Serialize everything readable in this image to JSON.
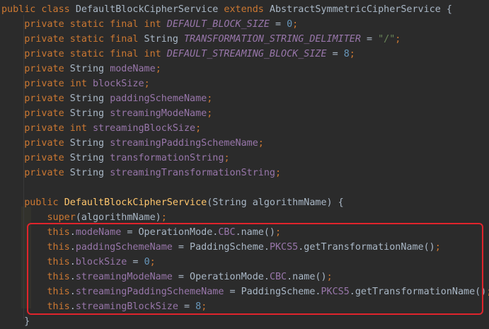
{
  "code": {
    "lines": [
      [
        {
          "t": "public class ",
          "c": "k"
        },
        {
          "t": "DefaultBlockCipherService ",
          "c": "p"
        },
        {
          "t": "extends ",
          "c": "k"
        },
        {
          "t": "AbstractSymmetricCipherService {",
          "c": "p"
        }
      ],
      [
        {
          "t": "    private static final int ",
          "c": "k"
        },
        {
          "t": "DEFAULT_BLOCK_SIZE",
          "c": "c"
        },
        {
          "t": " = ",
          "c": "p"
        },
        {
          "t": "0",
          "c": "n"
        },
        {
          "t": ";",
          "c": "k"
        }
      ],
      [
        {
          "t": "    private static final ",
          "c": "k"
        },
        {
          "t": "String ",
          "c": "p"
        },
        {
          "t": "TRANSFORMATION_STRING_DELIMITER",
          "c": "c"
        },
        {
          "t": " = ",
          "c": "p"
        },
        {
          "t": "\"/\"",
          "c": "s"
        },
        {
          "t": ";",
          "c": "k"
        }
      ],
      [
        {
          "t": "    private static final int ",
          "c": "k"
        },
        {
          "t": "DEFAULT_STREAMING_BLOCK_SIZE",
          "c": "c"
        },
        {
          "t": " = ",
          "c": "p"
        },
        {
          "t": "8",
          "c": "n"
        },
        {
          "t": ";",
          "c": "k"
        }
      ],
      [
        {
          "t": "    private ",
          "c": "k"
        },
        {
          "t": "String ",
          "c": "p"
        },
        {
          "t": "modeName",
          "c": "fi"
        },
        {
          "t": ";",
          "c": "k"
        }
      ],
      [
        {
          "t": "    private int ",
          "c": "k"
        },
        {
          "t": "blockSize",
          "c": "fi"
        },
        {
          "t": ";",
          "c": "k"
        }
      ],
      [
        {
          "t": "    private ",
          "c": "k"
        },
        {
          "t": "String ",
          "c": "p"
        },
        {
          "t": "paddingSchemeName",
          "c": "fi"
        },
        {
          "t": ";",
          "c": "k"
        }
      ],
      [
        {
          "t": "    private ",
          "c": "k"
        },
        {
          "t": "String ",
          "c": "p"
        },
        {
          "t": "streamingModeName",
          "c": "fi"
        },
        {
          "t": ";",
          "c": "k"
        }
      ],
      [
        {
          "t": "    private int ",
          "c": "k"
        },
        {
          "t": "streamingBlockSize",
          "c": "fi"
        },
        {
          "t": ";",
          "c": "k"
        }
      ],
      [
        {
          "t": "    private ",
          "c": "k"
        },
        {
          "t": "String ",
          "c": "p"
        },
        {
          "t": "streamingPaddingSchemeName",
          "c": "fi"
        },
        {
          "t": ";",
          "c": "k"
        }
      ],
      [
        {
          "t": "    private ",
          "c": "k"
        },
        {
          "t": "String ",
          "c": "p"
        },
        {
          "t": "transformationString",
          "c": "fi"
        },
        {
          "t": ";",
          "c": "k"
        }
      ],
      [
        {
          "t": "    private ",
          "c": "k"
        },
        {
          "t": "String ",
          "c": "p"
        },
        {
          "t": "streamingTransformationString",
          "c": "fi"
        },
        {
          "t": ";",
          "c": "k"
        }
      ],
      [],
      [
        {
          "t": "    public ",
          "c": "k"
        },
        {
          "t": "DefaultBlockCipherService",
          "c": "m"
        },
        {
          "t": "(String algorithmName) {",
          "c": "p"
        }
      ],
      [
        {
          "t": "        super",
          "c": "k"
        },
        {
          "t": "(algorithmName)",
          "c": "p"
        },
        {
          "t": ";",
          "c": "k"
        }
      ],
      [
        {
          "t": "        this",
          "c": "k"
        },
        {
          "t": ".",
          "c": "p"
        },
        {
          "t": "modeName",
          "c": "fi"
        },
        {
          "t": " = OperationMode.",
          "c": "p"
        },
        {
          "t": "CBC",
          "c": "fi"
        },
        {
          "t": ".name()",
          "c": "p"
        },
        {
          "t": ";",
          "c": "k"
        }
      ],
      [
        {
          "t": "        this",
          "c": "k"
        },
        {
          "t": ".",
          "c": "p"
        },
        {
          "t": "paddingSchemeName",
          "c": "fi"
        },
        {
          "t": " = PaddingScheme.",
          "c": "p"
        },
        {
          "t": "PKCS5",
          "c": "fi"
        },
        {
          "t": ".getTransformationName()",
          "c": "p"
        },
        {
          "t": ";",
          "c": "k"
        }
      ],
      [
        {
          "t": "        this",
          "c": "k"
        },
        {
          "t": ".",
          "c": "p"
        },
        {
          "t": "blockSize",
          "c": "fi"
        },
        {
          "t": " = ",
          "c": "p"
        },
        {
          "t": "0",
          "c": "n"
        },
        {
          "t": ";",
          "c": "k"
        }
      ],
      [
        {
          "t": "        this",
          "c": "k"
        },
        {
          "t": ".",
          "c": "p"
        },
        {
          "t": "streamingModeName",
          "c": "fi"
        },
        {
          "t": " = OperationMode.",
          "c": "p"
        },
        {
          "t": "CBC",
          "c": "fi"
        },
        {
          "t": ".name()",
          "c": "p"
        },
        {
          "t": ";",
          "c": "k"
        }
      ],
      [
        {
          "t": "        this",
          "c": "k"
        },
        {
          "t": ".",
          "c": "p"
        },
        {
          "t": "streamingPaddingSchemeName",
          "c": "fi"
        },
        {
          "t": " = PaddingScheme.",
          "c": "p"
        },
        {
          "t": "PKCS5",
          "c": "fi"
        },
        {
          "t": ".getTransformationName()",
          "c": "p"
        },
        {
          "t": ";",
          "c": "k"
        }
      ],
      [
        {
          "t": "        this",
          "c": "k"
        },
        {
          "t": ".",
          "c": "p"
        },
        {
          "t": "streamingBlockSize",
          "c": "fi"
        },
        {
          "t": " = ",
          "c": "p"
        },
        {
          "t": "8",
          "c": "n"
        },
        {
          "t": ";",
          "c": "k"
        }
      ],
      [
        {
          "t": "    }",
          "c": "p"
        }
      ]
    ]
  },
  "colors": {
    "background": "#2b2b2b",
    "keyword": "#cc7832",
    "number": "#6897bb",
    "string": "#6a8759",
    "field": "#9876aa",
    "method": "#ffc66d",
    "text": "#a9b7c6",
    "highlight_border": "#e0242c"
  }
}
